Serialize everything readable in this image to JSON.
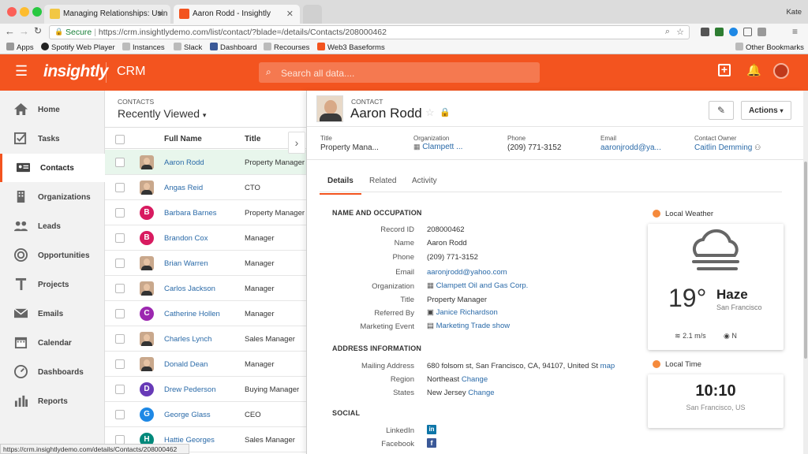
{
  "browser": {
    "tabs": [
      {
        "title": "Managing Relationships: Usin",
        "active": false
      },
      {
        "title": "Aaron Rodd - Insightly",
        "active": true
      }
    ],
    "user": "Kate",
    "secure_label": "Secure",
    "url": "https://crm.insightlydemo.com/list/contact/?blade=/details/Contacts/208000462",
    "bookmarks": [
      "Apps",
      "Spotify Web Player",
      "Instances",
      "Slack",
      "Dashboard",
      "Recourses",
      "Web3 Baseforms"
    ],
    "other_bookmarks": "Other Bookmarks",
    "status_url": "https://crm.insightlydemo.com/details/Contacts/208000462"
  },
  "header": {
    "logo": "insightly",
    "product": "CRM",
    "search_placeholder": "Search all data....",
    "accent": "#f3541f"
  },
  "sidebar": {
    "items": [
      {
        "label": "Home",
        "icon": "home-icon"
      },
      {
        "label": "Tasks",
        "icon": "tasks-icon"
      },
      {
        "label": "Contacts",
        "icon": "contacts-icon",
        "active": true
      },
      {
        "label": "Organizations",
        "icon": "organizations-icon"
      },
      {
        "label": "Leads",
        "icon": "leads-icon"
      },
      {
        "label": "Opportunities",
        "icon": "opportunities-icon"
      },
      {
        "label": "Projects",
        "icon": "projects-icon"
      },
      {
        "label": "Emails",
        "icon": "emails-icon"
      },
      {
        "label": "Calendar",
        "icon": "calendar-icon"
      },
      {
        "label": "Dashboards",
        "icon": "dashboards-icon"
      },
      {
        "label": "Reports",
        "icon": "reports-icon"
      }
    ]
  },
  "list": {
    "section": "CONTACTS",
    "view": "Recently Viewed",
    "columns": [
      "Full Name",
      "Title"
    ],
    "rows": [
      {
        "name": "Aaron Rodd",
        "title": "Property Manager",
        "avatar": "photo",
        "selected": true
      },
      {
        "name": "Angas Reid",
        "title": "CTO",
        "avatar": "photo"
      },
      {
        "name": "Barbara Barnes",
        "title": "Property Manager",
        "avatar": "B",
        "color": "#d81b60"
      },
      {
        "name": "Brandon Cox",
        "title": "Manager",
        "avatar": "B",
        "color": "#d81b60"
      },
      {
        "name": "Brian Warren",
        "title": "Manager",
        "avatar": "photo"
      },
      {
        "name": "Carlos Jackson",
        "title": "Manager",
        "avatar": "photo"
      },
      {
        "name": "Catherine Hollen",
        "title": "Manager",
        "avatar": "C",
        "color": "#9c27b0"
      },
      {
        "name": "Charles Lynch",
        "title": "Sales Manager",
        "avatar": "photo"
      },
      {
        "name": "Donald Dean",
        "title": "Manager",
        "avatar": "photo"
      },
      {
        "name": "Drew Pederson",
        "title": "Buying Manager",
        "avatar": "D",
        "color": "#673ab7"
      },
      {
        "name": "George Glass",
        "title": "CEO",
        "avatar": "G",
        "color": "#1e88e5"
      },
      {
        "name": "Hattie Georges",
        "title": "Sales Manager",
        "avatar": "H",
        "color": "#00897b"
      }
    ]
  },
  "contact": {
    "type_label": "CONTACT",
    "name": "Aaron Rodd",
    "actions_label": "Actions",
    "summary": [
      {
        "label": "Title",
        "value": "Property Mana..."
      },
      {
        "label": "Organization",
        "value": "Clampett ..."
      },
      {
        "label": "Phone",
        "value": "(209) 771-3152"
      },
      {
        "label": "Email",
        "value": "aaronjrodd@ya..."
      },
      {
        "label": "Contact Owner",
        "value": "Caitlin Demming"
      }
    ],
    "tabs": [
      "Details",
      "Related",
      "Activity"
    ],
    "sections": {
      "name_occupation": "NAME AND OCCUPATION",
      "address": "ADDRESS INFORMATION",
      "social": "SOCIAL"
    },
    "fields": {
      "record_id_label": "Record ID",
      "record_id": "208000462",
      "name_label": "Name",
      "name": "Aaron Rodd",
      "phone_label": "Phone",
      "phone": "(209) 771-3152",
      "email_label": "Email",
      "email": "aaronjrodd@yahoo.com",
      "org_label": "Organization",
      "org": "Clampett Oil and Gas Corp.",
      "title_label": "Title",
      "title": "Property Manager",
      "referred_label": "Referred By",
      "referred": "Janice Richardson",
      "event_label": "Marketing Event",
      "event": "Marketing Trade show",
      "mailing_label": "Mailing Address",
      "mailing": "680 folsom st, San Francisco, CA, 94107, United St",
      "map": "map",
      "region_label": "Region",
      "region": "Northeast",
      "states_label": "States",
      "states": "New Jersey",
      "change": "Change",
      "linkedin_label": "LinkedIn",
      "facebook_label": "Facebook"
    }
  },
  "weather": {
    "title": "Local Weather",
    "temp": "19°",
    "condition": "Haze",
    "city": "San Francisco",
    "wind": "2.1 m/s",
    "direction": "N"
  },
  "localtime": {
    "title": "Local Time",
    "time": "10:10",
    "place": "San Francisco, US"
  }
}
